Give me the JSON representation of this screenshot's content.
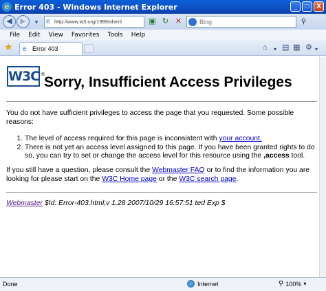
{
  "window": {
    "title": "Error 403 - Windows Internet Explorer",
    "minimize": "_",
    "maximize": "□",
    "close": "X"
  },
  "nav": {
    "url": "http://www.w3.org/1999/xhtml",
    "search_placeholder": "Bing"
  },
  "menu": {
    "items": [
      "File",
      "Edit",
      "View",
      "Favorites",
      "Tools",
      "Help"
    ]
  },
  "tab": {
    "label": "Error 403"
  },
  "page": {
    "heading": "Sorry, Insufficient Access Privileges",
    "intro": "You do not have sufficient privileges to access the page that you requested. Some possible reasons:",
    "reason1_text": "The level of access required for this page is inconsistent with ",
    "reason1_link": "your account.",
    "reason2_text_a": "There is not yet an access level assigned to this page. If you have been granted rights to do so, you can try to set or change the access level for this resource using the ",
    "reason2_bold": ",access",
    "reason2_text_b": " tool.",
    "question_a": "If you still have a question, please consult the ",
    "faq_link": "Webmaster FAQ",
    "question_b": " or to find the information you are looking for please start on the ",
    "home_link": "W3C Home page",
    "question_c": " or the ",
    "search_link": "W3C search page",
    "question_d": ".",
    "footer_link": "Webmaster",
    "footer_id": " $Id: Error-403.html,v 1.28 2007/10/29 16:57:51 ted Exp $",
    "logo_text": "W3C",
    "logo_reg": "®"
  },
  "status": {
    "text": "Done",
    "zone": "Internet",
    "zoom": "100%"
  },
  "colors": {
    "titlebar": "#0a5fd8",
    "link": "#0000cc",
    "visited_link": "#551a8b",
    "w3c_blue": "#1a4d8f"
  }
}
